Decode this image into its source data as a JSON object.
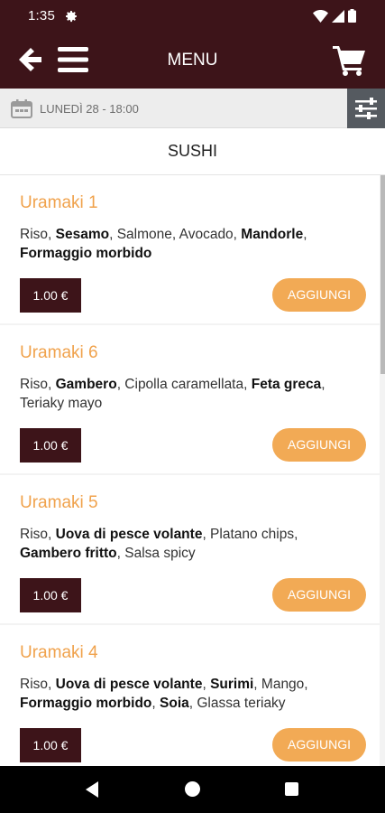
{
  "status_bar": {
    "time": "1:35"
  },
  "app_bar": {
    "title": "MENU"
  },
  "date_bar": {
    "text": "LUNEDÌ 28 - 18:00"
  },
  "section": {
    "title": "SUSHI"
  },
  "products": [
    {
      "name": "Uramaki 1",
      "ingredients": [
        {
          "text": "Riso",
          "bold": false
        },
        {
          "text": ", ",
          "bold": false
        },
        {
          "text": "Sesamo",
          "bold": true
        },
        {
          "text": ", Salmone, Avocado, ",
          "bold": false
        },
        {
          "text": "Mandorle",
          "bold": true
        },
        {
          "text": ", ",
          "bold": false
        },
        {
          "text": "Formaggio morbido",
          "bold": true
        }
      ],
      "price": "1.00 €",
      "button": "AGGIUNGI"
    },
    {
      "name": "Uramaki 6",
      "ingredients": [
        {
          "text": "Riso, ",
          "bold": false
        },
        {
          "text": "Gambero",
          "bold": true
        },
        {
          "text": ", Cipolla caramellata, ",
          "bold": false
        },
        {
          "text": "Feta greca",
          "bold": true
        },
        {
          "text": ", Teriaky mayo",
          "bold": false
        }
      ],
      "price": "1.00 €",
      "button": "AGGIUNGI"
    },
    {
      "name": "Uramaki 5",
      "ingredients": [
        {
          "text": "Riso, ",
          "bold": false
        },
        {
          "text": "Uova di pesce volante",
          "bold": true
        },
        {
          "text": ", Platano chips, ",
          "bold": false
        },
        {
          "text": "Gambero fritto",
          "bold": true
        },
        {
          "text": ", Salsa spicy",
          "bold": false
        }
      ],
      "price": "1.00 €",
      "button": "AGGIUNGI"
    },
    {
      "name": "Uramaki 4",
      "ingredients": [
        {
          "text": "Riso, ",
          "bold": false
        },
        {
          "text": "Uova di pesce volante",
          "bold": true
        },
        {
          "text": ", ",
          "bold": false
        },
        {
          "text": "Surimi",
          "bold": true
        },
        {
          "text": ", Mango, ",
          "bold": false
        },
        {
          "text": "Formaggio morbido",
          "bold": true
        },
        {
          "text": ", ",
          "bold": false
        },
        {
          "text": "Soia",
          "bold": true
        },
        {
          "text": ", Glassa teriaky",
          "bold": false
        }
      ],
      "price": "1.00 €",
      "button": "AGGIUNGI"
    }
  ],
  "icons": {
    "status": [
      "gear-icon",
      "wifi-icon",
      "signal-icon",
      "battery-icon"
    ],
    "app_bar": [
      "back-arrow-icon",
      "hamburger-menu-icon",
      "cart-icon"
    ],
    "date_bar": [
      "calendar-icon",
      "filter-sliders-icon"
    ],
    "nav_bar": [
      "nav-back-icon",
      "nav-home-icon",
      "nav-recents-icon"
    ]
  },
  "colors": {
    "brand_dark": "#3d1419",
    "accent_orange": "#f2aa55",
    "title_orange": "#f0a24c",
    "filter_gray": "#555a60"
  }
}
